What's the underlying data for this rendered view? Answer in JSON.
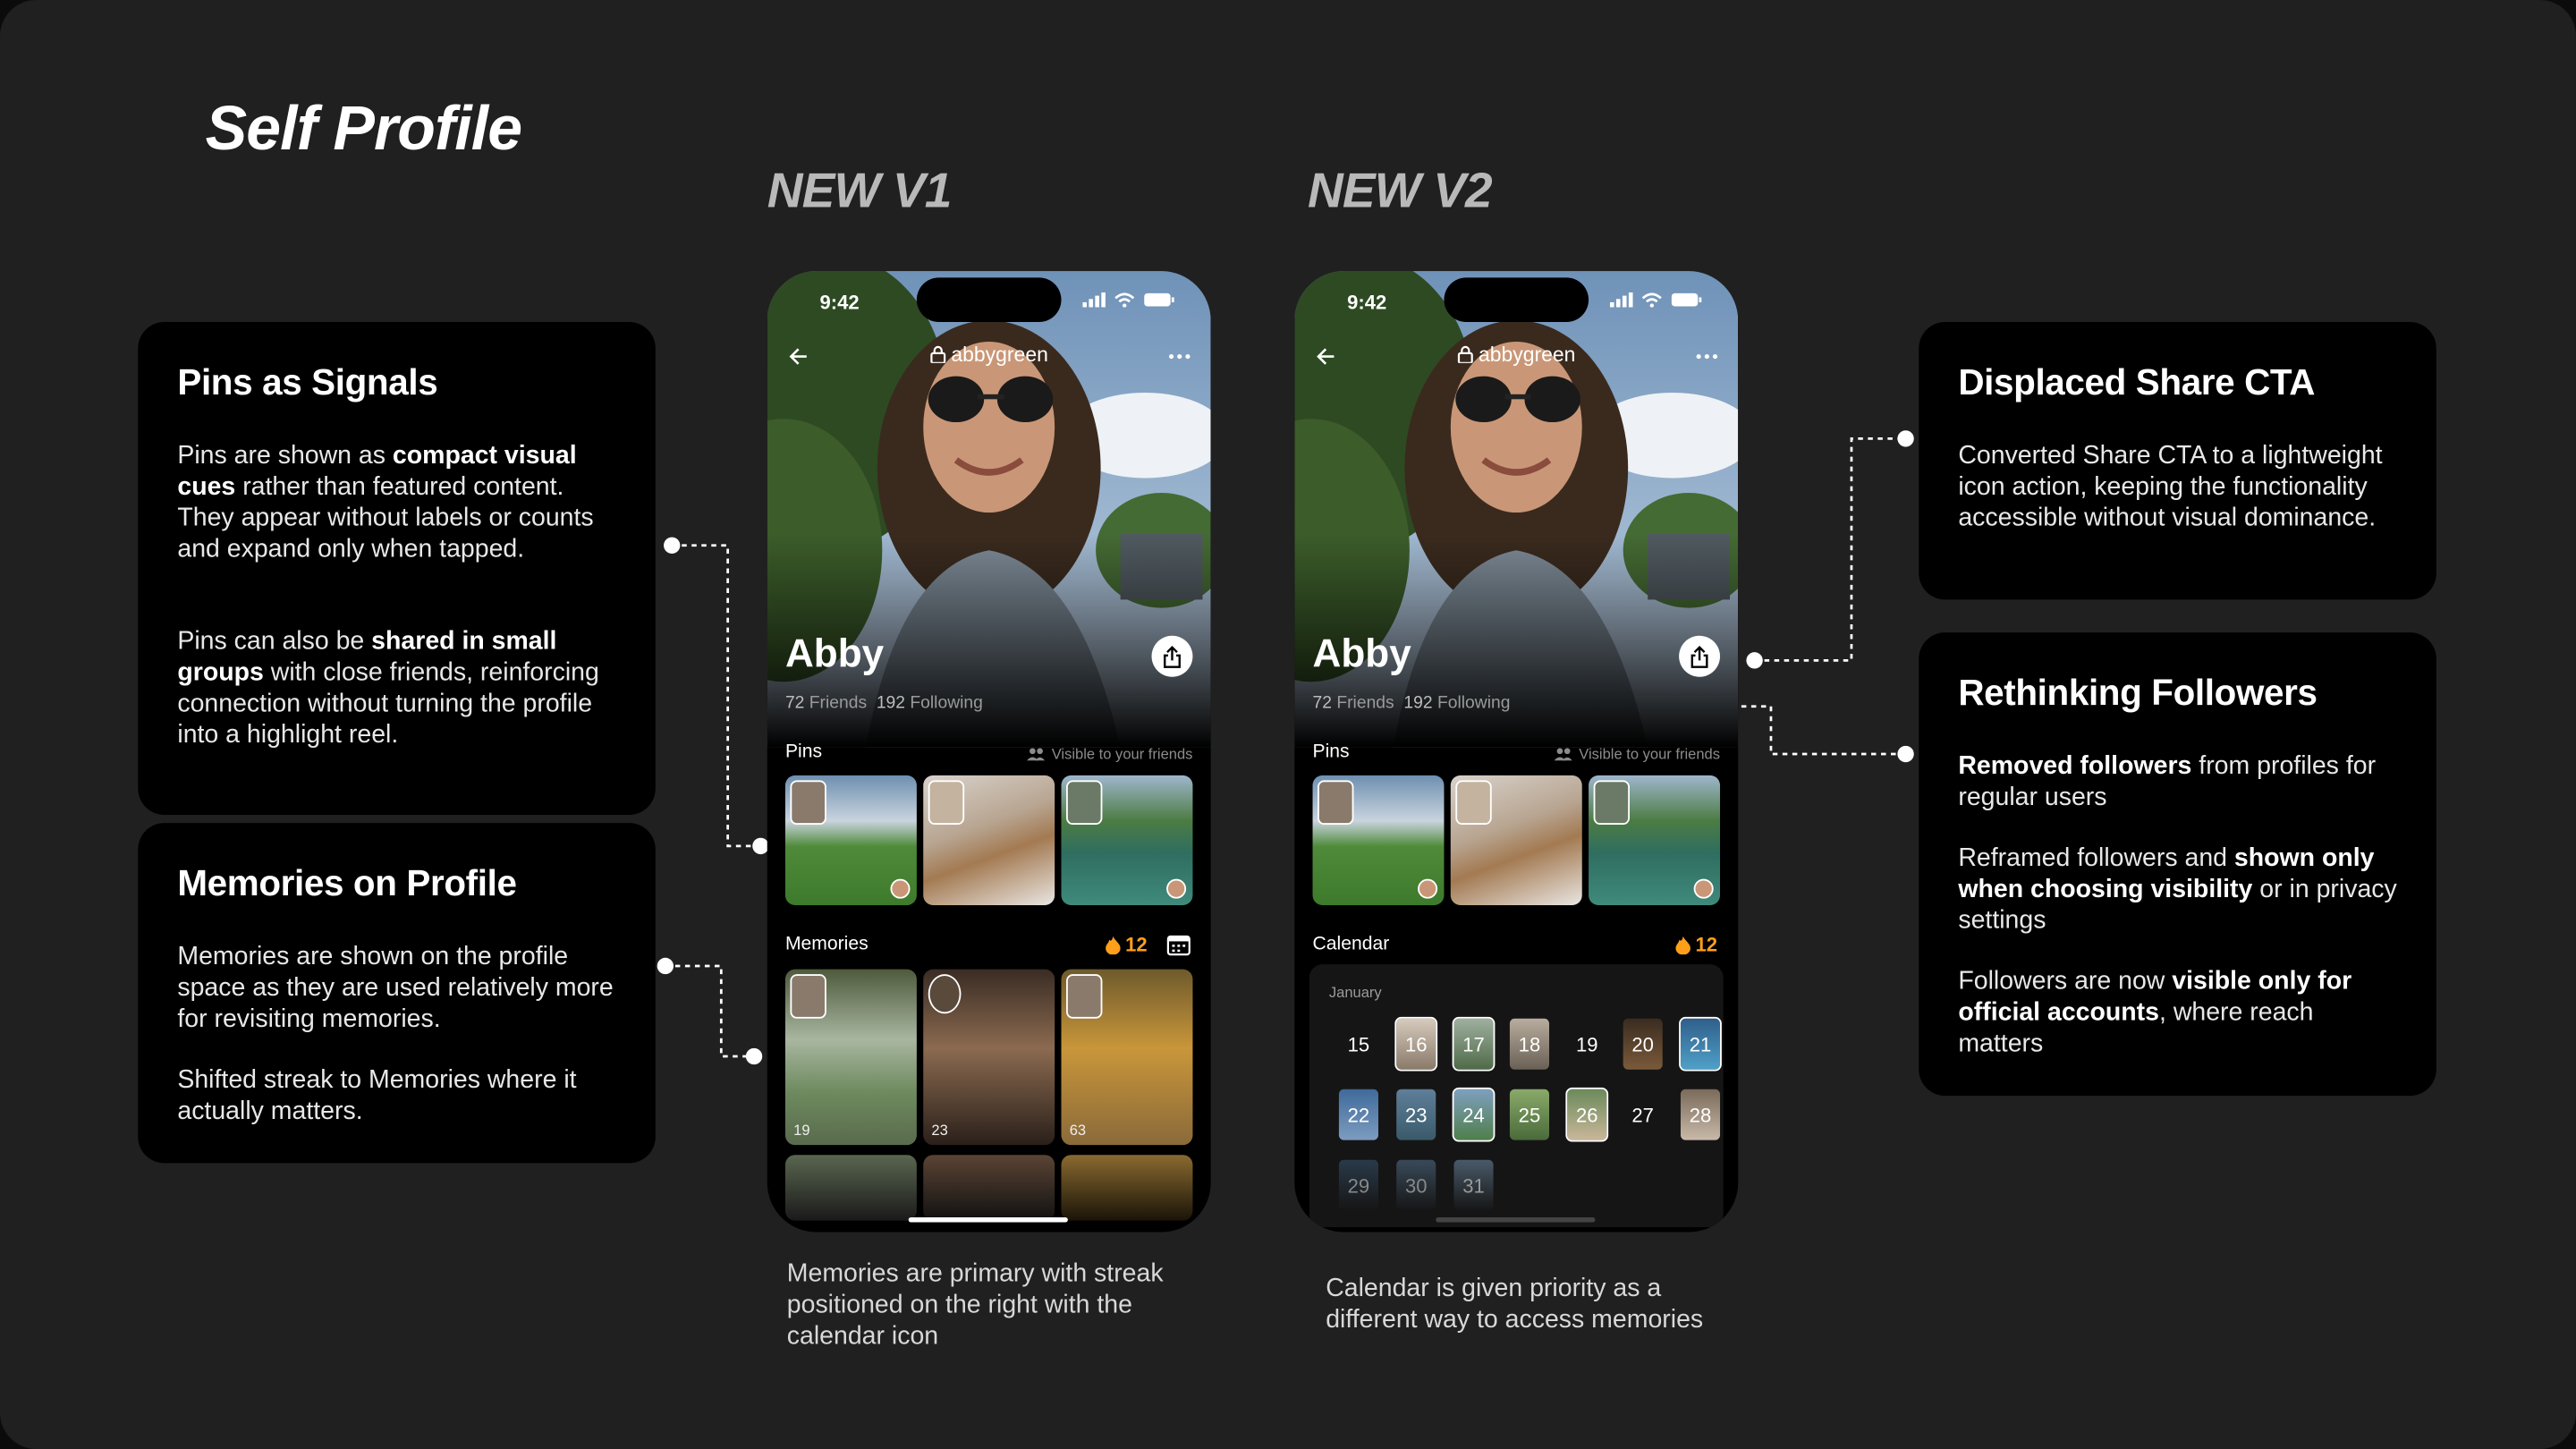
{
  "page_title": "Self Profile",
  "versions": {
    "v1": "NEW V1",
    "v2": "NEW V2"
  },
  "left_cards": [
    {
      "title": "Pins as Signals",
      "para1": [
        {
          "t": "Pins are shown as "
        },
        {
          "t": "compact visual cues",
          "b": true
        },
        {
          "t": " rather than featured content.  They appear without labels or counts and expand only when tapped."
        }
      ],
      "para2": [
        {
          "t": "Pins can also be "
        },
        {
          "t": "shared in small groups",
          "b": true
        },
        {
          "t": " with close friends, reinforcing connection without turning the profile into a highlight reel."
        }
      ]
    },
    {
      "title": "Memories on Profile",
      "para1": [
        {
          "t": "Memories are shown on the profile space as they are used relatively more for revisiting memories."
        }
      ],
      "para2": [
        {
          "t": "Shifted streak to Memories where it actually matters."
        }
      ]
    }
  ],
  "right_cards": [
    {
      "title": "Displaced Share CTA",
      "para1": [
        {
          "t": "Converted Share CTA to a lightweight icon action, keeping the functionality accessible without visual dominance."
        }
      ]
    },
    {
      "title": "Rethinking Followers",
      "para1": [
        {
          "t": "Removed followers",
          "b": true
        },
        {
          "t": " from profiles for regular users"
        }
      ],
      "para2": [
        {
          "t": "Reframed followers and "
        },
        {
          "t": "shown only when choosing visibility",
          "b": true
        },
        {
          "t": " or in privacy settings"
        }
      ],
      "para3": [
        {
          "t": "Followers are now "
        },
        {
          "t": "visible only for official accounts",
          "b": true
        },
        {
          "t": ", where reach matters"
        }
      ]
    }
  ],
  "phone": {
    "time": "9:42",
    "username": "abbygreen",
    "name": "Abby",
    "friends_count": "72",
    "friends_label": "Friends",
    "following_count": "192",
    "following_label": "Following",
    "pins_label": "Pins",
    "visibility_label": "Visible to your friends",
    "memories_label": "Memories",
    "calendar_label": "Calendar",
    "streak": "12",
    "memory_counts": [
      "19",
      "23",
      "63"
    ],
    "calendar_month": "January",
    "calendar_row1": [
      "15",
      "16",
      "17",
      "18",
      "19",
      "20",
      "21"
    ],
    "calendar_row2": [
      "22",
      "23",
      "24",
      "25",
      "26",
      "27",
      "28"
    ],
    "calendar_row3": [
      "29",
      "30",
      "31"
    ]
  },
  "captions": {
    "v1": "Memories are primary with streak positioned on the right with the calendar icon",
    "v2": "Calendar is given priority as a different way to access memories"
  },
  "colors": {
    "background": "#202020",
    "card": "#000000",
    "streak": "#ff9f1a",
    "version_label": "#b9b9b9"
  }
}
